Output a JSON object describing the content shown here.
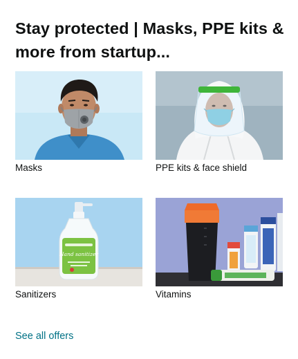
{
  "card": {
    "title": "Stay protected | Masks, PPE kits & more from startup...",
    "tiles": [
      {
        "label": "Masks",
        "image": "man-wearing-mask-photo"
      },
      {
        "label": "PPE kits & face shield",
        "image": "person-in-ppe-suit-photo"
      },
      {
        "label": "Sanitizers",
        "image": "hand-sanitizer-bottle-photo"
      },
      {
        "label": "Vitamins",
        "image": "shaker-and-vitamin-tubes-photo"
      }
    ],
    "see_all": "See all offers",
    "sanitizer_label": "Hand sanitizer"
  },
  "colors": {
    "link": "#007185",
    "text": "#0f1111"
  }
}
